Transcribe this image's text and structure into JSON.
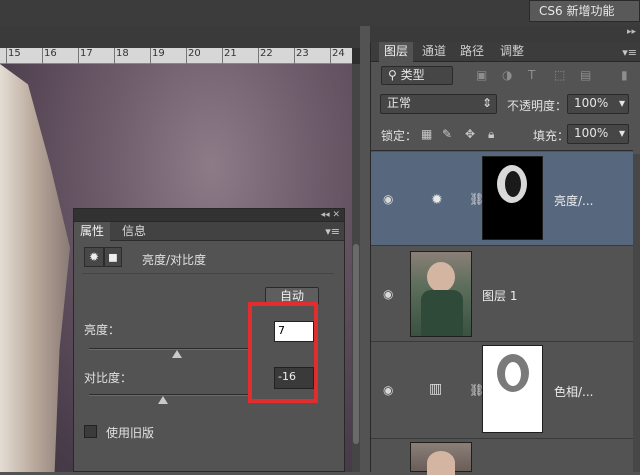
{
  "workspace": {
    "label": "CS6 新增功能"
  },
  "ruler": {
    "ticks": [
      "15",
      "16",
      "17",
      "18",
      "19",
      "20",
      "21",
      "22",
      "23",
      "24"
    ]
  },
  "properties_panel": {
    "tabs": [
      "属性",
      "信息"
    ],
    "adjustment_title": "亮度/对比度",
    "auto_button": "自动",
    "brightness_label": "亮度：",
    "brightness_value": "7",
    "brightness_level": 0.55,
    "contrast_label": "对比度：",
    "contrast_value": "-16",
    "contrast_level": 0.46,
    "legacy_label": "使用旧版",
    "legacy_checked": false
  },
  "layers_panel": {
    "tabs": [
      "图层",
      "通道",
      "路径",
      "调整"
    ],
    "filter_kind": "类型",
    "blend_mode": "正常",
    "opacity_label": "不透明度：",
    "opacity_value": "100%",
    "lock_label": "锁定：",
    "fill_label": "填充：",
    "fill_value": "100%",
    "layers": [
      {
        "name": "亮度/...",
        "type": "adjustment",
        "icon": "sun-icon",
        "selected": true,
        "visible": true
      },
      {
        "name": "图层 1",
        "type": "pixel",
        "selected": false,
        "visible": true
      },
      {
        "name": "色相/...",
        "type": "adjustment",
        "icon": "hue-saturation-icon",
        "selected": false,
        "visible": true
      }
    ]
  },
  "colors": {
    "highlight": "#e02e2e",
    "selected_layer": "#56677e"
  }
}
